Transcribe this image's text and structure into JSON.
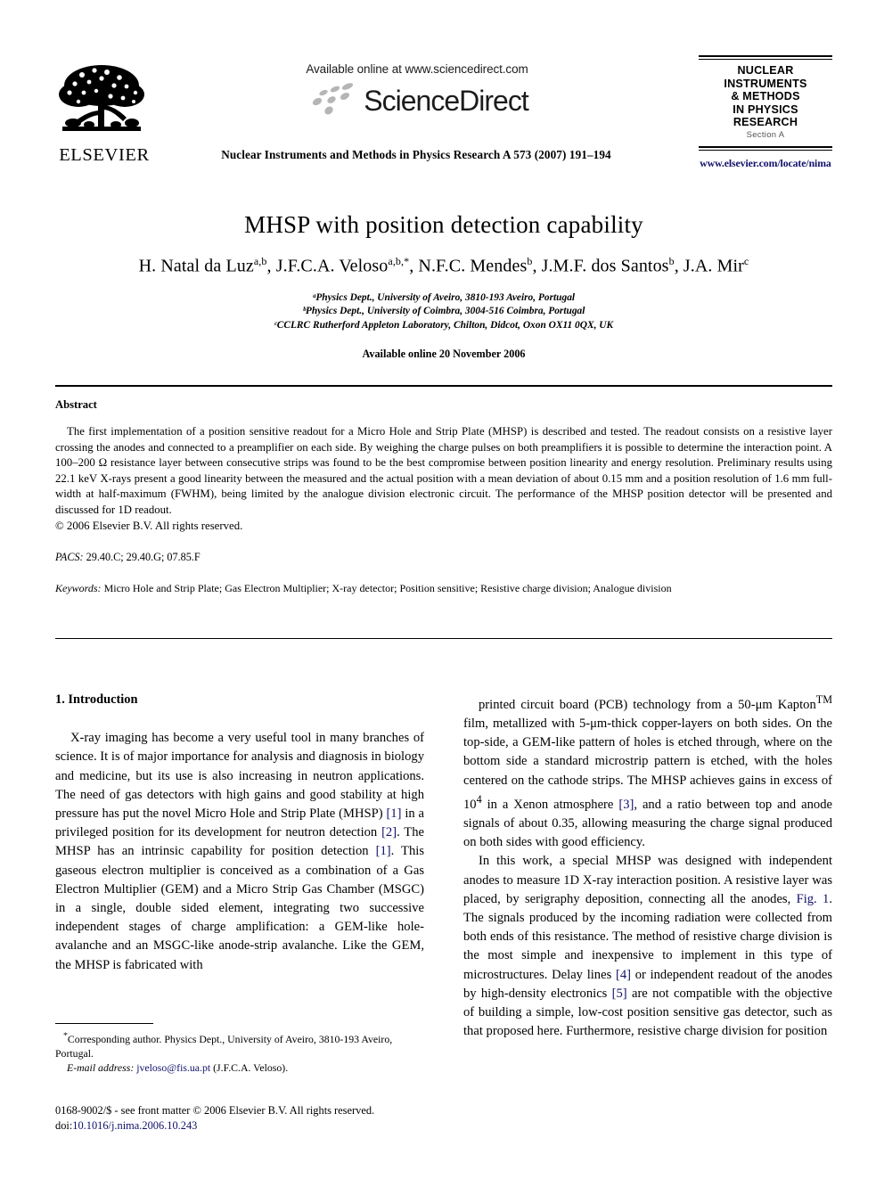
{
  "masthead": {
    "publisher_name": "ELSEVIER",
    "publisher_logo_icon": "elsevier-tree-icon",
    "sciencedirect": {
      "available_line": "Available online at www.sciencedirect.com",
      "wordmark": "ScienceDirect",
      "swoosh_icon": "sciencedirect-swoosh-icon"
    },
    "journal_reference": "Nuclear Instruments and Methods in Physics Research A 573 (2007) 191–194",
    "journal_logo": {
      "line1": "NUCLEAR",
      "line2": "INSTRUMENTS",
      "line3": "& METHODS",
      "line4": "IN PHYSICS",
      "line5": "RESEARCH",
      "section": "Section A"
    },
    "journal_url": "www.elsevier.com/locate/nima"
  },
  "article": {
    "title": "MHSP with position detection capability",
    "authors_html": "H. Natal da Luz<sup>a,b</sup>, J.F.C.A. Veloso<sup>a,b,*</sup>, N.F.C. Mendes<sup>b</sup>, J.M.F. dos Santos<sup>b</sup>, J.A. Mir<sup>c</sup>",
    "affiliations": [
      "ᵃPhysics Dept., University of Aveiro, 3810-193 Aveiro, Portugal",
      "ᵇPhysics Dept., University of Coimbra, 3004-516 Coimbra, Portugal",
      "ᶜCCLRC Rutherford Appleton Laboratory, Chilton, Didcot, Oxon OX11 0QX, UK"
    ],
    "available_online": "Available online 20 November 2006"
  },
  "abstract": {
    "heading": "Abstract",
    "body": "The first implementation of a position sensitive readout for a Micro Hole and Strip Plate (MHSP) is described and tested. The readout consists on a resistive layer crossing the anodes and connected to a preamplifier on each side. By weighing the charge pulses on both preamplifiers it is possible to determine the interaction point. A 100–200 Ω resistance layer between consecutive strips was found to be the best compromise between position linearity and energy resolution. Preliminary results using 22.1 keV X-rays present a good linearity between the measured and the actual position with a mean deviation of about 0.15 mm and a position resolution of 1.6 mm full-width at half-maximum (FWHM), being limited by the analogue division electronic circuit. The performance of the MHSP position detector will be presented and discussed for 1D readout.",
    "copyright": "© 2006 Elsevier B.V. All rights reserved.",
    "pacs_label": "PACS:",
    "pacs_value": "29.40.C; 29.40.G; 07.85.F",
    "keywords_label": "Keywords:",
    "keywords_value": "Micro Hole and Strip Plate; Gas Electron Multiplier; X-ray detector; Position sensitive; Resistive charge division; Analogue division"
  },
  "body": {
    "section_heading": "1. Introduction",
    "left_paragraph_1_html": "X-ray imaging has become a very useful tool in many branches of science. It is of major importance for analysis and diagnosis in biology and medicine, but its use is also increasing in neutron applications. The need of gas detectors with high gains and good stability at high pressure has put the novel Micro Hole and Strip Plate (MHSP) <span class=\"ref\">[1]</span> in a privileged position for its development for neutron detection <span class=\"ref\">[2]</span>. The MHSP has an intrinsic capability for position detection <span class=\"ref\">[1]</span>. This gaseous electron multiplier is conceived as a combination of a Gas Electron Multiplier (GEM) and a Micro Strip Gas Chamber (MSGC) in a single, double sided element, integrating two successive independent stages of charge amplification: a GEM-like hole-avalanche and an MSGC-like anode-strip avalanche. Like the GEM, the MHSP is fabricated with",
    "right_paragraph_1_html": "printed circuit board (PCB) technology from a 50-μm Kapton<sup>TM</sup> film, metallized with 5-μm-thick copper-layers on both sides. On the top-side, a GEM-like pattern of holes is etched through, where on the bottom side a standard microstrip pattern is etched, with the holes centered on the cathode strips. The MHSP achieves gains in excess of 10<sup>4</sup> in a Xenon atmosphere <span class=\"ref\">[3]</span>, and a ratio between top and anode signals of about 0.35, allowing measuring the charge signal produced on both sides with good efficiency.",
    "right_paragraph_2_html": "In this work, a special MHSP was designed with independent anodes to measure 1D X-ray interaction position. A resistive layer was placed, by serigraphy deposition, connecting all the anodes, <span class=\"ref\">Fig. 1</span>. The signals produced by the incoming radiation were collected from both ends of this resistance. The method of resistive charge division is the most simple and inexpensive to implement in this type of microstructures. Delay lines <span class=\"ref\">[4]</span> or independent readout of the anodes by high-density electronics <span class=\"ref\">[5]</span> are not compatible with the objective of building a simple, low-cost position sensitive gas detector, such as that proposed here. Furthermore, resistive charge division for position"
  },
  "footnote": {
    "corresponding_html": "<sup>*</sup>Corresponding author. Physics Dept., University of Aveiro, 3810-193 Aveiro, Portugal.",
    "email_label": "E-mail address:",
    "email_address": "jveloso@fis.ua.pt",
    "email_owner": "(J.F.C.A. Veloso).",
    "issn_line": "0168-9002/$ - see front matter © 2006 Elsevier B.V. All rights reserved.",
    "doi_label": "doi:",
    "doi_value": "10.1016/j.nima.2006.10.243"
  },
  "colors": {
    "link": "#10106a",
    "text": "#000000",
    "paper": "#ffffff"
  }
}
